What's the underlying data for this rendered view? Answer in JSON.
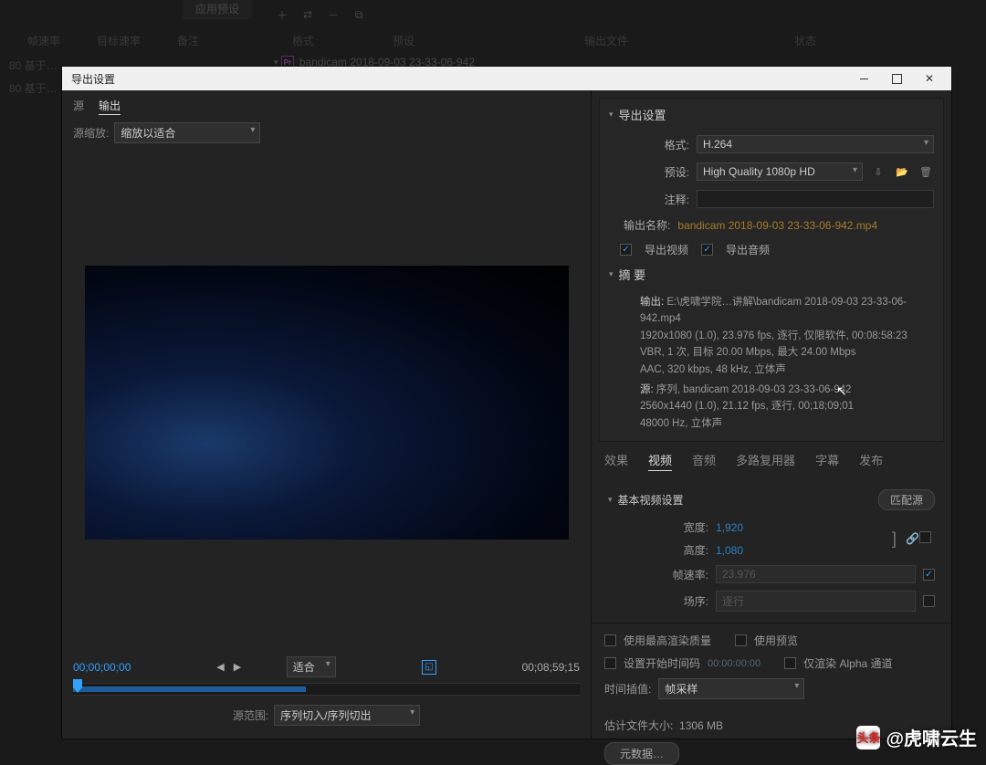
{
  "bg": {
    "apply_preset": "应用预设",
    "cols": {
      "format": "格式",
      "preset": "预设",
      "output_file": "输出文件",
      "status": "状态",
      "fps": "帧速率",
      "target_rate": "目标速率",
      "notes": "备注"
    },
    "left_items": [
      "80  基于…",
      "80  基于…"
    ],
    "queue_item": "bandicam 2018-09-03 23-33-06-942",
    "pr_abbrev": "Pr"
  },
  "dialog": {
    "title": "导出设置",
    "tabs": {
      "source": "源",
      "output": "输出"
    },
    "scale_label": "源缩放:",
    "scale_value": "缩放以适合"
  },
  "transport": {
    "in_tc": "00;00;00;00",
    "out_tc": "00;08;59;15",
    "fit": "适合",
    "range_label": "源范围:",
    "range_value": "序列切入/序列切出"
  },
  "export": {
    "header": "导出设置",
    "format_label": "格式:",
    "format_value": "H.264",
    "preset_label": "预设:",
    "preset_value": "High Quality 1080p HD",
    "comment_label": "注释:",
    "outname_label": "输出名称:",
    "outname_value": "bandicam 2018-09-03 23-33-06-942.mp4",
    "export_video": "导出视频",
    "export_audio": "导出音频"
  },
  "summary": {
    "header": "摘 要",
    "out_k": "输出:",
    "out_l1": "E:\\虎啸学院…讲解\\bandicam 2018-09-03 23-33-06-942.mp4",
    "out_l2": "1920x1080 (1.0), 23.976 fps, 逐行, 仅限软件, 00:08:58:23",
    "out_l3": "VBR, 1 次, 目标 20.00 Mbps, 最大 24.00 Mbps",
    "out_l4": "AAC, 320 kbps, 48 kHz, 立体声",
    "src_k": "源:",
    "src_l1": "序列, bandicam 2018-09-03 23-33-06-942",
    "src_l2": "2560x1440 (1.0), 21.12 fps, 逐行, 00;18;09;01",
    "src_l3": "48000 Hz, 立体声"
  },
  "tabs": {
    "effects": "效果",
    "video": "视频",
    "audio": "音频",
    "mux": "多路复用器",
    "captions": "字幕",
    "publish": "发布"
  },
  "video": {
    "header": "基本视频设置",
    "match": "匹配源",
    "width_label": "宽度:",
    "width_value": "1,920",
    "height_label": "高度:",
    "height_value": "1,080",
    "fps_label": "帧速率:",
    "fps_value": "23.976",
    "order_label": "场序:",
    "order_value": "逐行"
  },
  "bottom": {
    "max_quality": "使用最高渲染质量",
    "preview": "使用预览",
    "set_tc": "设置开始时间码",
    "tc": "00:00:00:00",
    "alpha": "仅渲染 Alpha 通道",
    "interp_label": "时间插值:",
    "interp_value": "帧采样",
    "filesize_label": "估计文件大小:",
    "filesize_value": "1306 MB",
    "metadata": "元数据…"
  },
  "watermark": {
    "logo": "头条",
    "text": "@虎啸云生"
  }
}
